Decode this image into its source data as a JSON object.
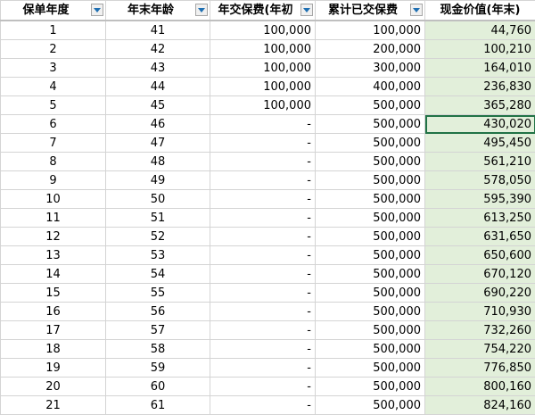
{
  "columns": [
    {
      "label": "保单年度"
    },
    {
      "label": "年末年龄"
    },
    {
      "label": "年交保费(年初"
    },
    {
      "label": "累计已交保费"
    },
    {
      "label": "现金价值(年末)"
    }
  ],
  "rows": [
    {
      "year": "1",
      "age": "41",
      "premium": "100,000",
      "cumulative": "100,000",
      "cash": "44,760"
    },
    {
      "year": "2",
      "age": "42",
      "premium": "100,000",
      "cumulative": "200,000",
      "cash": "100,210"
    },
    {
      "year": "3",
      "age": "43",
      "premium": "100,000",
      "cumulative": "300,000",
      "cash": "164,010"
    },
    {
      "year": "4",
      "age": "44",
      "premium": "100,000",
      "cumulative": "400,000",
      "cash": "236,830"
    },
    {
      "year": "5",
      "age": "45",
      "premium": "100,000",
      "cumulative": "500,000",
      "cash": "365,280"
    },
    {
      "year": "6",
      "age": "46",
      "premium": "-",
      "cumulative": "500,000",
      "cash": "430,020"
    },
    {
      "year": "7",
      "age": "47",
      "premium": "-",
      "cumulative": "500,000",
      "cash": "495,450"
    },
    {
      "year": "8",
      "age": "48",
      "premium": "-",
      "cumulative": "500,000",
      "cash": "561,210"
    },
    {
      "year": "9",
      "age": "49",
      "premium": "-",
      "cumulative": "500,000",
      "cash": "578,050"
    },
    {
      "year": "10",
      "age": "50",
      "premium": "-",
      "cumulative": "500,000",
      "cash": "595,390"
    },
    {
      "year": "11",
      "age": "51",
      "premium": "-",
      "cumulative": "500,000",
      "cash": "613,250"
    },
    {
      "year": "12",
      "age": "52",
      "premium": "-",
      "cumulative": "500,000",
      "cash": "631,650"
    },
    {
      "year": "13",
      "age": "53",
      "premium": "-",
      "cumulative": "500,000",
      "cash": "650,600"
    },
    {
      "year": "14",
      "age": "54",
      "premium": "-",
      "cumulative": "500,000",
      "cash": "670,120"
    },
    {
      "year": "15",
      "age": "55",
      "premium": "-",
      "cumulative": "500,000",
      "cash": "690,220"
    },
    {
      "year": "16",
      "age": "56",
      "premium": "-",
      "cumulative": "500,000",
      "cash": "710,930"
    },
    {
      "year": "17",
      "age": "57",
      "premium": "-",
      "cumulative": "500,000",
      "cash": "732,260"
    },
    {
      "year": "18",
      "age": "58",
      "premium": "-",
      "cumulative": "500,000",
      "cash": "754,220"
    },
    {
      "year": "19",
      "age": "59",
      "premium": "-",
      "cumulative": "500,000",
      "cash": "776,850"
    },
    {
      "year": "20",
      "age": "60",
      "premium": "-",
      "cumulative": "500,000",
      "cash": "800,160"
    },
    {
      "year": "21",
      "age": "61",
      "premium": "-",
      "cumulative": "500,000",
      "cash": "824,160"
    }
  ],
  "selected_row": 5,
  "colors": {
    "cash_column_fill": "#e2efda",
    "selection_border": "#217346",
    "filter_arrow": "#1f6fb2"
  },
  "icons": {
    "filter": "filter-dropdown-icon"
  }
}
